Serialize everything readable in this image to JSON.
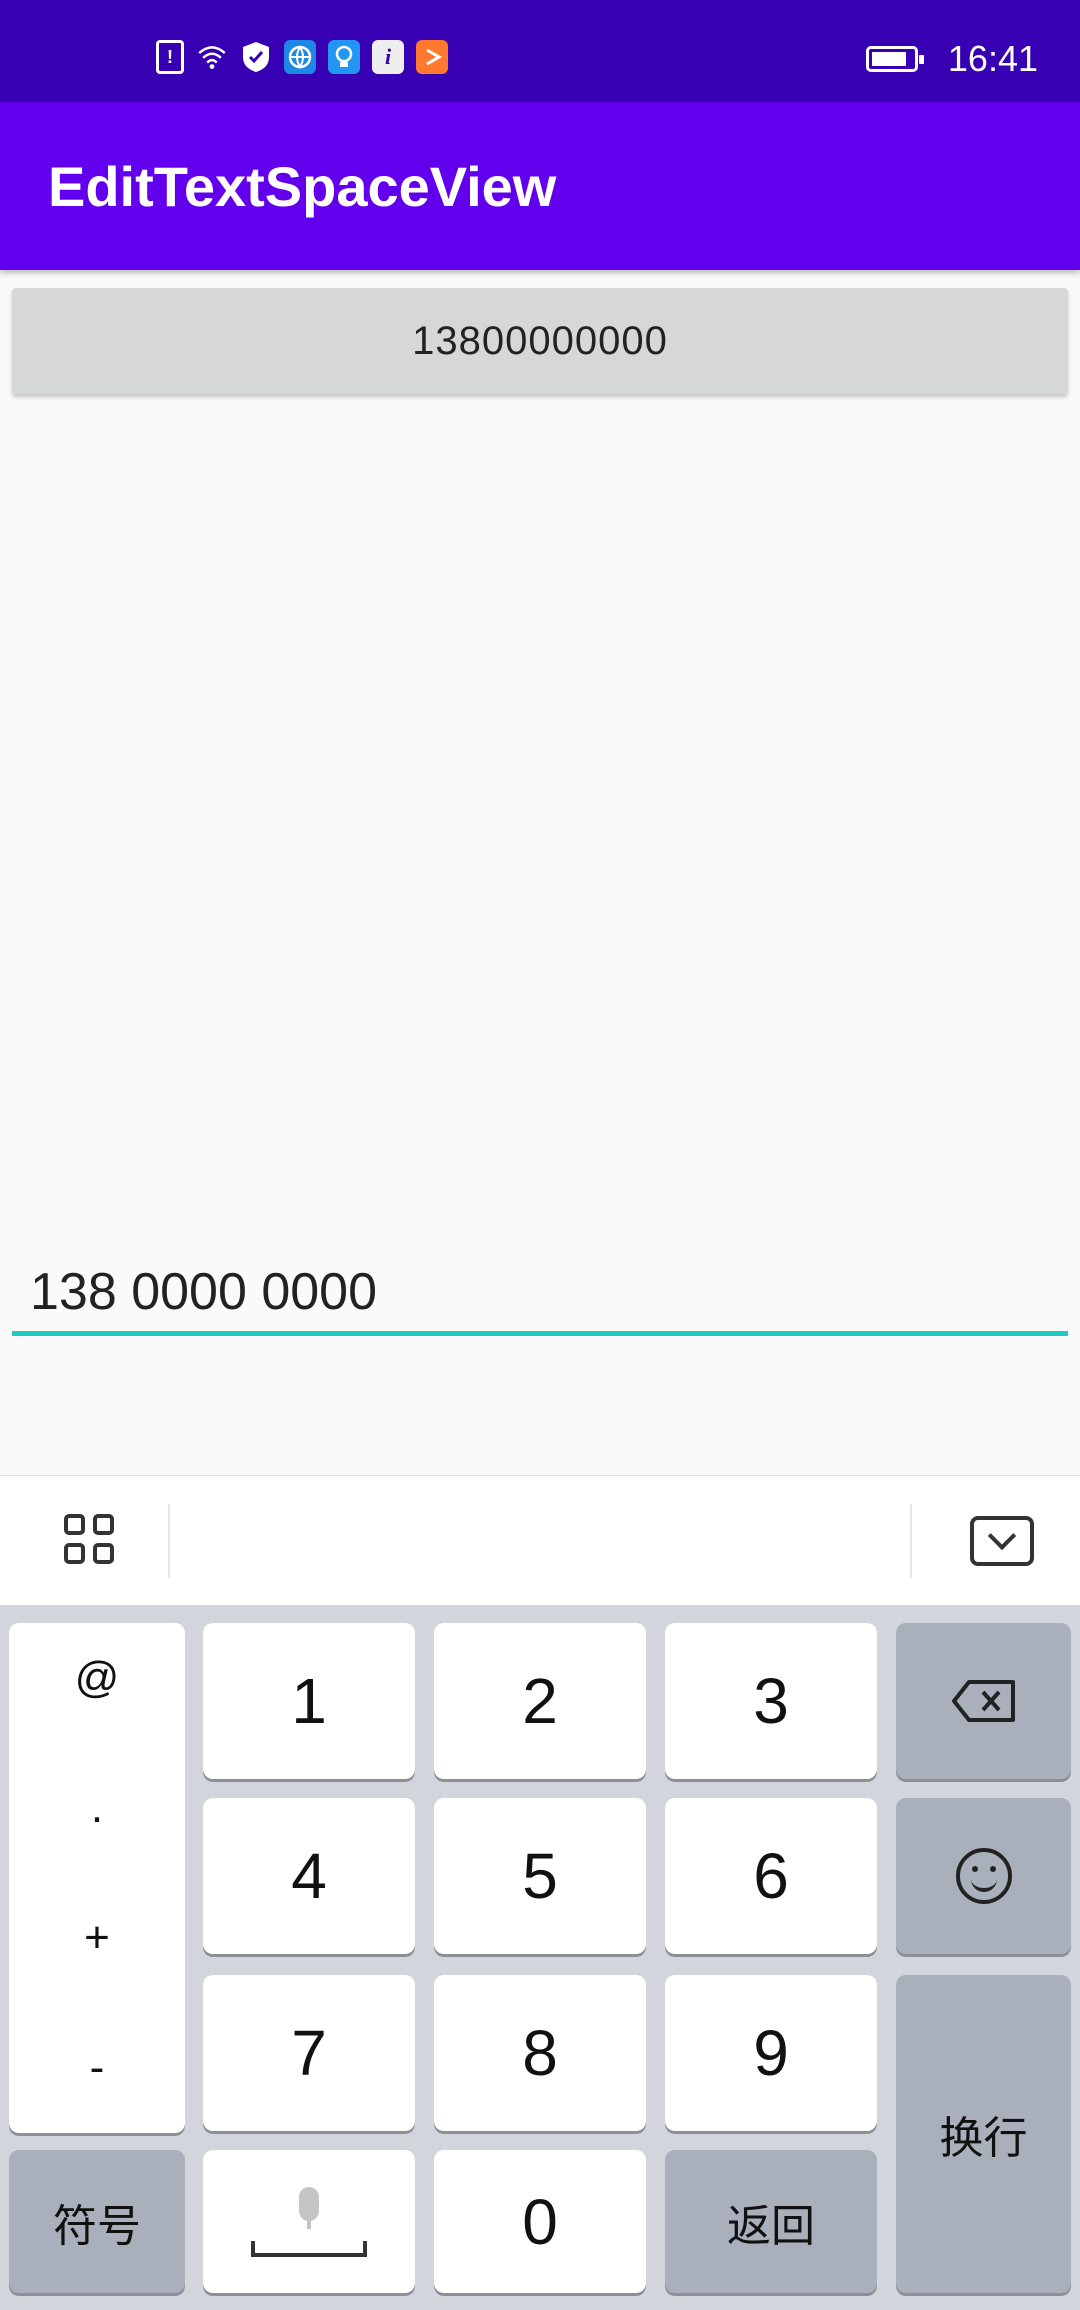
{
  "status_bar": {
    "time": "16:41",
    "icons": [
      "alert-icon",
      "wifi-icon",
      "shield-icon",
      "browser-icon",
      "bulb-icon",
      "info-icon",
      "video-icon"
    ],
    "battery_icon": "battery-icon"
  },
  "app_bar": {
    "title": "EditTextSpaceView"
  },
  "main": {
    "button_label": "13800000000",
    "edit_value": "138 0000 0000",
    "accent_color": "#1ecbc0"
  },
  "keyboard_toolbar": {
    "left_icon": "grid-icon",
    "right_icon": "collapse-keyboard-icon"
  },
  "keyboard": {
    "symbol_column": [
      "@",
      ".",
      "+",
      "-"
    ],
    "digits": [
      "1",
      "2",
      "3",
      "4",
      "5",
      "6",
      "7",
      "8",
      "9",
      "0"
    ],
    "symbols_label": "符号",
    "back_label": "返回",
    "enter_label": "换行",
    "backspace_icon": "backspace-icon",
    "emoji_icon": "emoji-icon",
    "space_icon": "microphone-space-icon"
  },
  "colors": {
    "status_bar": "#3700b3",
    "app_bar": "#6200ee",
    "button_bg": "#d6d7d7",
    "keyboard_bg": "#d3d5dc",
    "function_key": "#aab0bb"
  }
}
